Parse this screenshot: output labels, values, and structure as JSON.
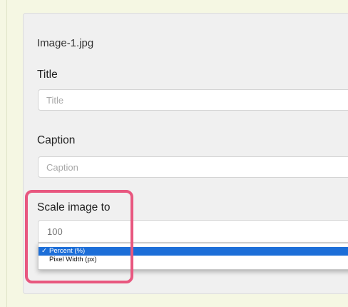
{
  "attachment": {
    "filename": "Image-1.jpg"
  },
  "title_field": {
    "label": "Title",
    "value": "",
    "placeholder": "Title"
  },
  "caption_field": {
    "label": "Caption",
    "value": "",
    "placeholder": "Caption"
  },
  "scale_field": {
    "label": "Scale image to",
    "value": "",
    "placeholder": "100",
    "dropdown": {
      "options": [
        {
          "label": "Percent (%)",
          "selected": true,
          "check": "✓"
        },
        {
          "label": "Pixel Width (px)",
          "selected": false,
          "check": ""
        }
      ]
    }
  },
  "colors": {
    "page_background": "#f5f7e3",
    "panel_background": "#f0f0f0",
    "selection_blue": "#1c6ed8",
    "highlight_pink": "#e8577f"
  }
}
